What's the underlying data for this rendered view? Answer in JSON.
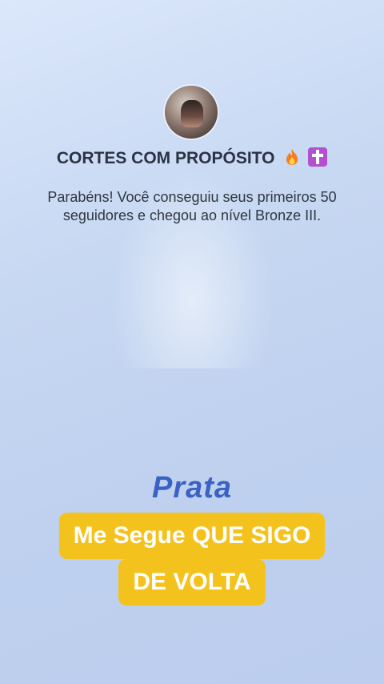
{
  "profile": {
    "name": "CORTES COM PROPÓSITO",
    "icons": [
      "fire-emoji",
      "latin-cross-emoji"
    ]
  },
  "message": "Parabéns! Você conseguiu seus primeiros 50 seguidores e chegou ao nível Bronze III.",
  "level": "Prata",
  "caption": {
    "line1": "Me Segue QUE SIGO",
    "line2": "DE VOLTA"
  },
  "colors": {
    "accent": "#3a62c4",
    "caption_background": "#f3c21c"
  }
}
